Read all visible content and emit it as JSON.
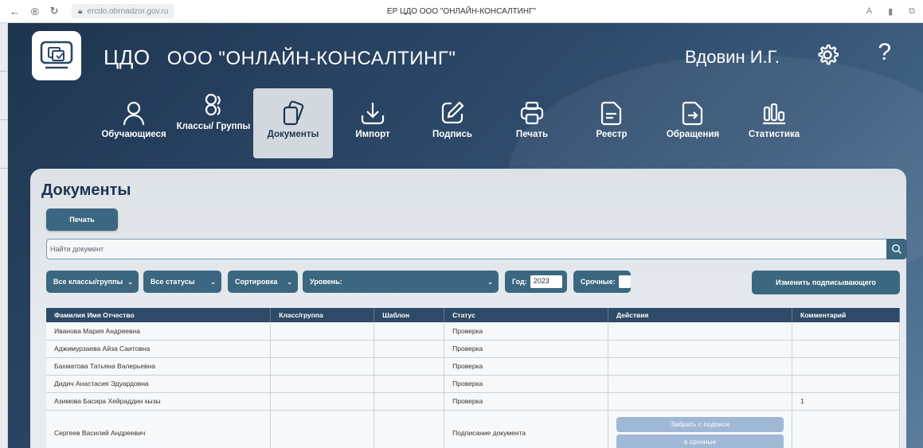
{
  "browser": {
    "url": "ercdo.obrnadzor.gov.ru",
    "title": "ЕР ЦДО ООО \"ОНЛАЙН-КОНСАЛТИНГ\""
  },
  "header": {
    "brand": "ЦДО",
    "org": "ООО \"ОНЛАЙН-КОНСАЛТИНГ\"",
    "user": "Вдовин И.Г.",
    "help": "?"
  },
  "tabs": [
    {
      "label": "Обучающиеся",
      "icon": "person-icon"
    },
    {
      "label": "Классы/ Группы",
      "icon": "group-icon"
    },
    {
      "label": "Документы",
      "icon": "documents-icon",
      "active": true
    },
    {
      "label": "Импорт",
      "icon": "import-icon"
    },
    {
      "label": "Подпись",
      "icon": "sign-icon"
    },
    {
      "label": "Печать",
      "icon": "printer-icon"
    },
    {
      "label": "Реестр",
      "icon": "registry-icon"
    },
    {
      "label": "Обращения",
      "icon": "appeal-icon"
    },
    {
      "label": "Статистика",
      "icon": "stats-icon"
    }
  ],
  "page": {
    "title": "Документы",
    "print_label": "Печать",
    "search_placeholder": "Найти документ",
    "filters": {
      "classes": "Все классы/группы",
      "statuses": "Все статусы",
      "sort": "Сортировка",
      "level": "Уровень:",
      "year_label": "Год:",
      "year_value": "2023",
      "urgent_label": "Срочные:"
    },
    "change_signer_label": "Изменить подписывающего"
  },
  "table": {
    "headers": [
      "Фамилия Имя Отчество",
      "Класс/группа",
      "Шаблон",
      "Статус",
      "Действия",
      "Комментарий"
    ],
    "rows": [
      {
        "name": "Иванова Мария Андреевна",
        "group": "",
        "template": "",
        "status": "Проверка",
        "comment": ""
      },
      {
        "name": "Аджимурзаева Айза Саитовна",
        "group": "",
        "template": "",
        "status": "Проверка",
        "comment": ""
      },
      {
        "name": "Бахматова Татьяна Валерьевна",
        "group": "",
        "template": "",
        "status": "Проверка",
        "comment": ""
      },
      {
        "name": "Дидич Анастасия Эдуардовна",
        "group": "",
        "template": "",
        "status": "Проверка",
        "comment": ""
      },
      {
        "name": "Азимова Басира Хейраддин кызы",
        "group": "",
        "template": "",
        "status": "Проверка",
        "comment": "1"
      },
      {
        "name": "Сергеев Василий Андреевич",
        "group": "",
        "template": "",
        "status": "Подписание документа",
        "comment": "",
        "actions": [
          "Забрать с подписи",
          "в срочные"
        ]
      }
    ]
  }
}
